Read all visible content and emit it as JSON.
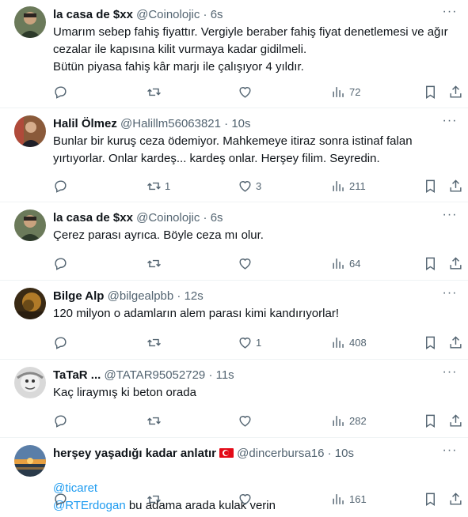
{
  "tweets": [
    {
      "name": "la casa de $xx",
      "handle": "@Coinolojic",
      "time": "6s",
      "text": "Umarım sebep fahiş fiyattır. Vergiyle beraber  fahiş fiyat denetlemesi ve ağır\ncezalar ile kapısına kilit vurmaya kadar gidilmeli.\nBütün piyasa fahiş kâr marjı ile çalışıyor 4 yıldır.",
      "replies": "",
      "retweets": "",
      "likes": "",
      "views": "72"
    },
    {
      "name": "Halil Ölmez",
      "handle": "@Halillm56063821",
      "time": "10s",
      "text": "Bunlar bir kuruş ceza ödemiyor. Mahkemeye itiraz sonra istinaf falan\nyırtıyorlar. Onlar kardeş... kardeş onlar. Herşey filim. Seyredin.",
      "replies": "",
      "retweets": "1",
      "likes": "3",
      "views": "211"
    },
    {
      "name": "la casa de $xx",
      "handle": "@Coinolojic",
      "time": "6s",
      "text": "Çerez parası ayrıca. Böyle ceza mı olur.",
      "replies": "",
      "retweets": "",
      "likes": "",
      "views": "64"
    },
    {
      "name": "Bilge Alp",
      "handle": "@bilgealpbb",
      "time": "12s",
      "text": "120 milyon o adamların alem parası kimi kandırıyorlar!",
      "replies": "",
      "retweets": "",
      "likes": "1",
      "views": "408"
    },
    {
      "name": "TaTaR ...",
      "handle": "@TATAR95052729",
      "time": "11s",
      "text": "Kaç liraymış ki beton orada",
      "replies": "",
      "retweets": "",
      "likes": "",
      "views": "282"
    },
    {
      "name": "herşey yaşadığı kadar anlatır",
      "handle": "@dincerbursa16",
      "time": "10s",
      "mention1": "@ticaret",
      "mention2": "@RTErdogan",
      "text": "  bu adama arada kulak verin",
      "replies": "",
      "retweets": "",
      "likes": "",
      "views": "161"
    }
  ],
  "separator": "·",
  "more_glyph": "···",
  "colors": {
    "text": "#0f1419",
    "secondary": "#536471",
    "link": "#1d9bf0",
    "divider": "#eff3f4"
  },
  "icons": [
    "reply-icon",
    "retweet-icon",
    "like-icon",
    "views-icon",
    "bookmark-icon",
    "share-icon",
    "more-icon",
    "turkey-flag-icon"
  ]
}
